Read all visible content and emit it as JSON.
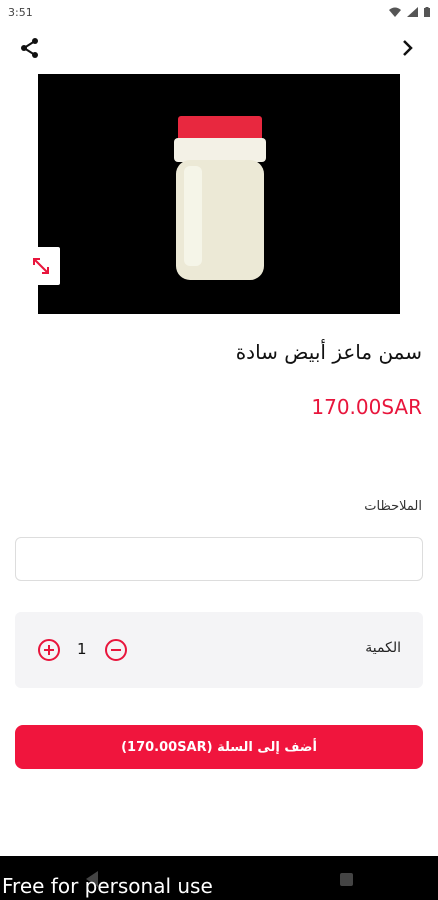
{
  "status": {
    "time": "3:51"
  },
  "product": {
    "title": "سمن ماعز أبيض سادة",
    "price": "170.00SAR"
  },
  "notes": {
    "label": "الملاحظات",
    "value": ""
  },
  "quantity": {
    "label": "الكمية",
    "value": "1"
  },
  "cart": {
    "button_label": "أضف إلى السلة (170.00SAR)"
  },
  "watermark": {
    "text": "Free for personal use"
  },
  "colors": {
    "accent": "#f0153d",
    "price": "#e8153c",
    "panel": "#f4f4f6"
  }
}
